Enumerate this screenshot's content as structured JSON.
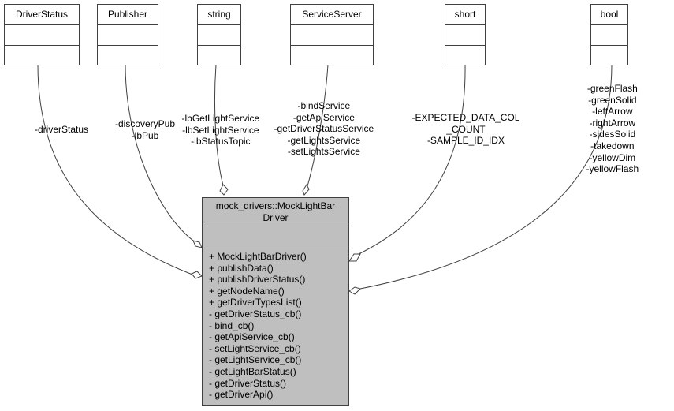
{
  "classes": [
    {
      "id": "DriverStatus",
      "name": "DriverStatus"
    },
    {
      "id": "Publisher",
      "name": "Publisher"
    },
    {
      "id": "string",
      "name": "string"
    },
    {
      "id": "ServiceServer",
      "name": "ServiceServer"
    },
    {
      "id": "short",
      "name": "short"
    },
    {
      "id": "bool",
      "name": "bool"
    }
  ],
  "main_class": {
    "title_line1": "mock_drivers::MockLightBar",
    "title_line2": "Driver",
    "operations": [
      "+ MockLightBarDriver()",
      "+ publishData()",
      "+ publishDriverStatus()",
      "+ getNodeName()",
      "+ getDriverTypesList()",
      "- getDriverStatus_cb()",
      "- bind_cb()",
      "- getApiService_cb()",
      "- setLightService_cb()",
      "- getLightService_cb()",
      "- getLightBarStatus()",
      "- getDriverStatus()",
      "- getDriverApi()"
    ]
  },
  "edges": [
    {
      "from": "DriverStatus",
      "labels": [
        "-driverStatus"
      ]
    },
    {
      "from": "Publisher",
      "labels": [
        "-discoveryPub",
        "-lbPub"
      ]
    },
    {
      "from": "string",
      "labels": [
        "-lbGetLightService",
        "-lbSetLightService",
        "-lbStatusTopic"
      ]
    },
    {
      "from": "ServiceServer",
      "labels": [
        "-bindService",
        "-getApiService",
        "-getDriverStatusService",
        "-getLightsService",
        "-setLightsService"
      ]
    },
    {
      "from": "short",
      "labels": [
        "-EXPECTED_DATA_COL",
        "_COUNT",
        "-SAMPLE_ID_IDX"
      ]
    },
    {
      "from": "bool",
      "labels": [
        "-greenFlash",
        "-greenSolid",
        "-leftArrow",
        "-rightArrow",
        "-sidesSolid",
        "-takedown",
        "-yellowDim",
        "-yellowFlash"
      ]
    }
  ]
}
